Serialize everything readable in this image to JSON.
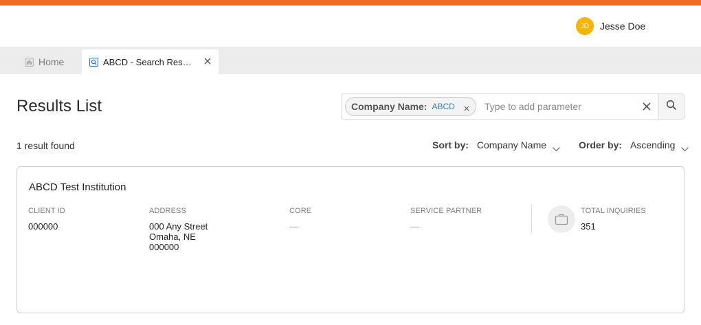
{
  "colors": {
    "accent": "#f26b21",
    "avatar": "#f7b500",
    "chip_value": "#2f7fc1"
  },
  "user": {
    "initials": "JD",
    "name": "Jesse Doe"
  },
  "tabs": [
    {
      "label": "Home",
      "icon": "home-icon",
      "active": false
    },
    {
      "label": "ABCD - Search Results",
      "icon": "search-page-icon",
      "active": true,
      "closable": true
    }
  ],
  "page": {
    "title": "Results List"
  },
  "search": {
    "chips": [
      {
        "key": "Company Name:",
        "value": "ABCD"
      }
    ],
    "placeholder": "Type to add parameter",
    "value": ""
  },
  "results": {
    "count_text": "1 result found"
  },
  "sort": {
    "sort_by_label": "Sort by:",
    "sort_by_value": "Company Name",
    "order_by_label": "Order by:",
    "order_by_value": "Ascending"
  },
  "items": [
    {
      "name": "ABCD Test Institution",
      "client_id_label": "CLIENT ID",
      "client_id": "000000",
      "address_label": "ADDRESS",
      "address_line1": "000 Any Street",
      "address_line2": "Omaha, NE",
      "address_line3": "000000",
      "core_label": "CORE",
      "core": "—",
      "service_partner_label": "SERVICE PARTNER",
      "service_partner": "—",
      "total_inquiries_label": "TOTAL INQUIRIES",
      "total_inquiries": "351",
      "icon": "briefcase-icon"
    }
  ]
}
